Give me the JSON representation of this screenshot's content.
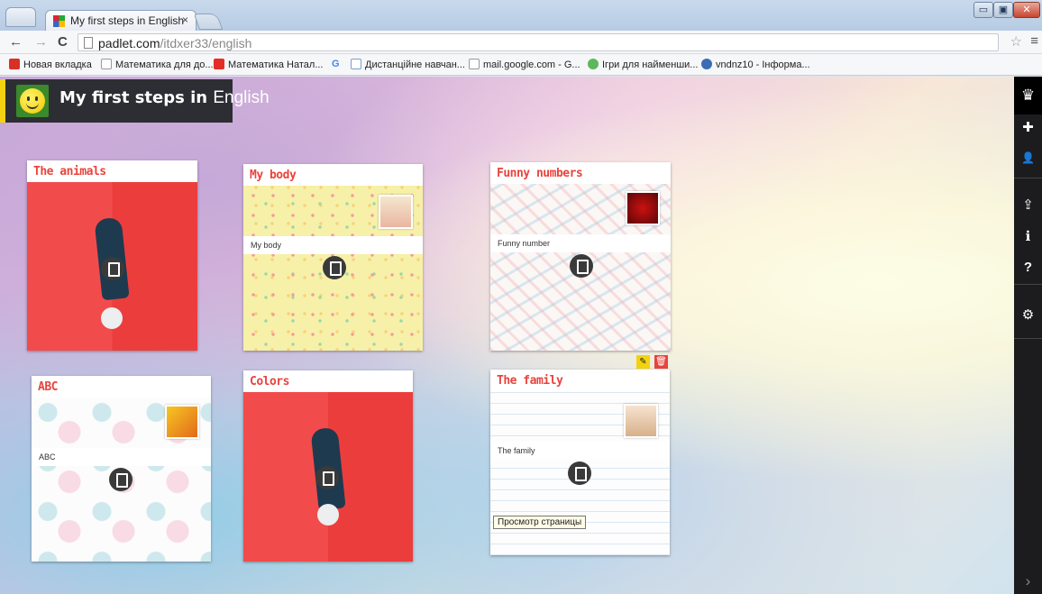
{
  "browser": {
    "tab_title": "My first steps in English",
    "tab_close": "×",
    "url_host": "padlet.com",
    "url_path": "/itdxer33/english",
    "window_controls": {
      "minimize": "▭",
      "maximize": "▣",
      "close": "✕"
    }
  },
  "nav": {
    "back": "←",
    "forward": "→",
    "reload": "C",
    "star": "☆",
    "menu": "≡"
  },
  "bookmarks": [
    {
      "label": "Новая вкладка",
      "icon": "gmail-icon",
      "color": "#d93025"
    },
    {
      "label": "Математика для до...",
      "icon": "page-icon",
      "color": "#999999"
    },
    {
      "label": "Математика Натал...",
      "icon": "youtube-icon",
      "color": "#e52d27"
    },
    {
      "label": "",
      "icon": "google-icon",
      "color": "#4285f4"
    },
    {
      "label": "Дистанційне навчан...",
      "icon": "pf-icon",
      "color": "#7aa0c8"
    },
    {
      "label": "mail.google.com - G...",
      "icon": "page-icon",
      "color": "#999999"
    },
    {
      "label": "Ігри для найменши...",
      "icon": "game-icon",
      "color": "#5cb85c"
    },
    {
      "label": "vndnz10 - Інформа...",
      "icon": "globe-icon",
      "color": "#3b6db5"
    }
  ],
  "google_glyph": "G",
  "padlet": {
    "title_bold": "My first steps in",
    "title_light": "English",
    "accent": "#f4d20f"
  },
  "sidebar": [
    {
      "name": "crown-icon",
      "glyph": "♛"
    },
    {
      "name": "add-icon",
      "glyph": "✚"
    },
    {
      "name": "user-icon",
      "glyph": "👤"
    },
    {
      "name": "share-icon",
      "glyph": "⇪"
    },
    {
      "name": "info-icon",
      "glyph": "ℹ"
    },
    {
      "name": "help-icon",
      "glyph": "?"
    },
    {
      "name": "settings-icon",
      "glyph": "⚙"
    },
    {
      "name": "expand-icon",
      "glyph": "›"
    }
  ],
  "cards": {
    "animals": {
      "title": "The animals"
    },
    "body": {
      "title": "My body",
      "label": "My body"
    },
    "numbers": {
      "title": "Funny numbers",
      "label": "Funny number"
    },
    "abc": {
      "title": "ABC",
      "label": "ABC"
    },
    "colors": {
      "title": "Colors"
    },
    "family": {
      "title": "The family",
      "label": "The family",
      "edit": "✎",
      "delete": "🗑"
    }
  },
  "tooltip": "Просмотр страницы"
}
